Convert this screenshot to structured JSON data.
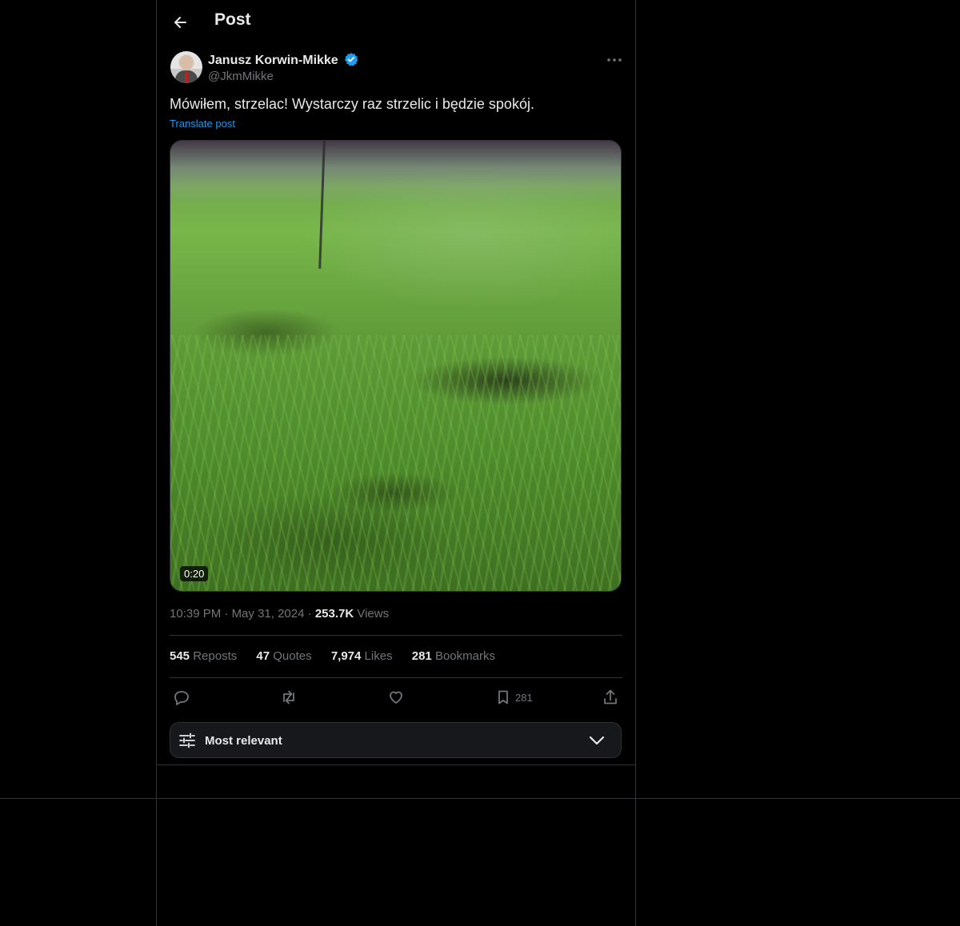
{
  "header": {
    "title": "Post",
    "back_icon": "arrow-left-icon"
  },
  "author": {
    "name": "Janusz Korwin-Mikke",
    "handle": "@JkmMikke",
    "verified": true,
    "verified_color": "#1d9bf0"
  },
  "post": {
    "text": "Mówiłem, strzelac! Wystarczy raz strzelic i będzie spokój.",
    "translate_label": "Translate post",
    "media": {
      "type": "video",
      "duration": "0:20"
    },
    "time": "10:39 PM",
    "date": "May 31, 2024",
    "views_count": "253.7K",
    "views_label": "Views"
  },
  "stats": {
    "reposts_count": "545",
    "reposts_label": "Reposts",
    "quotes_count": "47",
    "quotes_label": "Quotes",
    "likes_count": "7,974",
    "likes_label": "Likes",
    "bookmarks_count": "281",
    "bookmarks_label": "Bookmarks"
  },
  "actions": {
    "reply_icon": "reply-icon",
    "repost_icon": "repost-icon",
    "like_icon": "heart-icon",
    "bookmark_icon": "bookmark-icon",
    "bookmark_count": "281",
    "share_icon": "share-icon"
  },
  "replies_sort": {
    "label": "Most relevant",
    "icon": "sliders-icon",
    "chevron": "chevron-down-icon"
  },
  "colors": {
    "background": "#000000",
    "text": "#e7e9ea",
    "muted": "#71767b",
    "accent": "#1d9bf0",
    "border": "#2f3336"
  }
}
